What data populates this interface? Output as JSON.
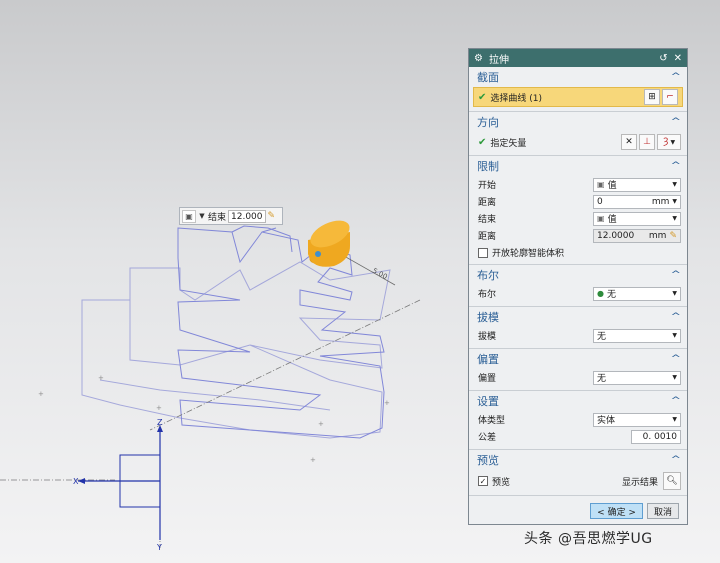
{
  "viewport": {
    "mini_toolbar": {
      "mode_icon": "extrude-type-icon",
      "label": "结束",
      "value": "12.000"
    },
    "axis_labels": {
      "z": "Z",
      "x": "X",
      "y": "Y"
    },
    "dimension_label": "5.00"
  },
  "dialog": {
    "title": "拉伸",
    "sections": {
      "section_face": {
        "header": "截面",
        "select_curve": "选择曲线 (1)"
      },
      "direction": {
        "header": "方向",
        "specify_vector": "指定矢量"
      },
      "limits": {
        "header": "限制",
        "start_label": "开始",
        "start_value": "值",
        "start_distance_label": "距离",
        "start_distance_value": "0",
        "start_distance_unit": "mm",
        "end_label": "结束",
        "end_value": "值",
        "end_distance_label": "距离",
        "end_distance_value": "12.0000",
        "end_distance_unit": "mm",
        "open_profile": "开放轮廓智能体积"
      },
      "boolean": {
        "header": "布尔",
        "label": "布尔",
        "value": "无"
      },
      "draft": {
        "header": "拔模",
        "label": "拔模",
        "value": "无"
      },
      "offset": {
        "header": "偏置",
        "label": "偏置",
        "value": "无"
      },
      "settings": {
        "header": "设置",
        "body_type_label": "体类型",
        "body_type_value": "实体",
        "tolerance_label": "公差",
        "tolerance_value": "0. 0010"
      },
      "preview": {
        "header": "预览",
        "preview_label": "预览",
        "show_result": "显示结果"
      }
    },
    "footer": {
      "ok": "< 确定 >",
      "cancel": "取消"
    }
  },
  "watermark": "头条 @吾思燃学UG"
}
